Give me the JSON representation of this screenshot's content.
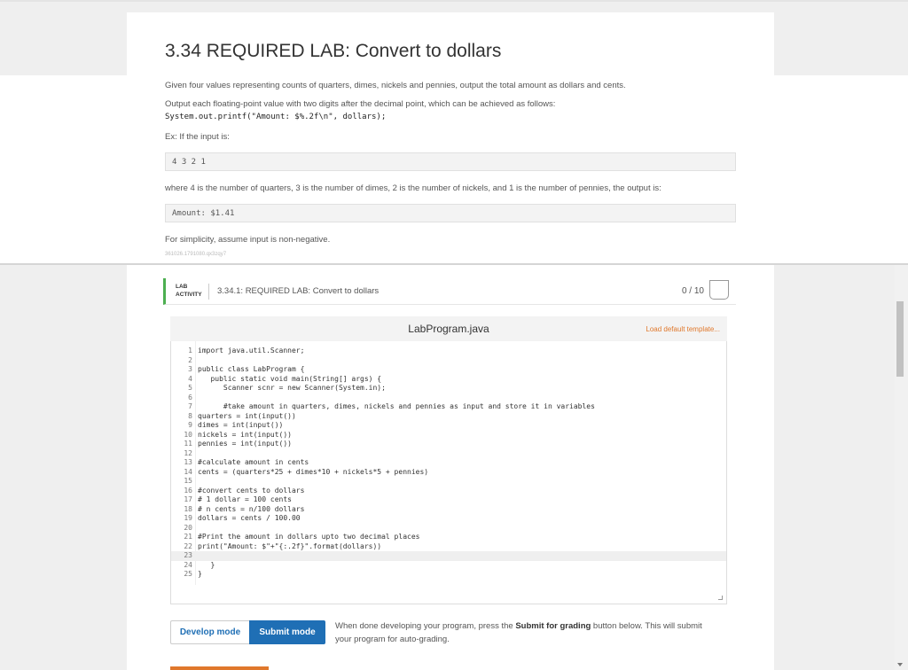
{
  "problem": {
    "title": "3.34 REQUIRED LAB: Convert to dollars",
    "intro": "Given four values representing counts of quarters, dimes, nickels and pennies, output the total amount as dollars and cents.",
    "output_note": "Output each floating-point value with two digits after the decimal point, which can be achieved as follows:",
    "printf_code": "System.out.printf(\"Amount: $%.2f\\n\", dollars);",
    "example_label": "Ex: If the input is:",
    "example_input": "4 3 2 1",
    "where_text": "where 4 is the number of quarters, 3 is the number of dimes, 2 is the number of nickels, and 1 is the number of pennies, the output is:",
    "example_output": "Amount: $1.41",
    "simplicity_note": "For simplicity, assume input is non-negative.",
    "tiny_id": "361026.1791080.qx3zqy7"
  },
  "activity": {
    "type_line1": "LAB",
    "type_line2": "ACTIVITY",
    "title": "3.34.1: REQUIRED LAB: Convert to dollars",
    "score": "0 / 10"
  },
  "editor": {
    "filename": "LabProgram.java",
    "load_template": "Load default template...",
    "lines": [
      {
        "n": "1",
        "text": "import java.util.Scanner;"
      },
      {
        "n": "2",
        "text": ""
      },
      {
        "n": "3",
        "text": "public class LabProgram {"
      },
      {
        "n": "4",
        "text": "   public static void main(String[] args) {"
      },
      {
        "n": "5",
        "text": "      Scanner scnr = new Scanner(System.in);"
      },
      {
        "n": "6",
        "text": ""
      },
      {
        "n": "7",
        "text": "      #take amount in quarters, dimes, nickels and pennies as input and store it in variables"
      },
      {
        "n": "8",
        "text": "quarters = int(input())"
      },
      {
        "n": "9",
        "text": "dimes = int(input())"
      },
      {
        "n": "10",
        "text": "nickels = int(input())"
      },
      {
        "n": "11",
        "text": "pennies = int(input())"
      },
      {
        "n": "12",
        "text": ""
      },
      {
        "n": "13",
        "text": "#calculate amount in cents"
      },
      {
        "n": "14",
        "text": "cents = (quarters*25 + dimes*10 + nickels*5 + pennies)"
      },
      {
        "n": "15",
        "text": ""
      },
      {
        "n": "16",
        "text": "#convert cents to dollars"
      },
      {
        "n": "17",
        "text": "# 1 dollar = 100 cents"
      },
      {
        "n": "18",
        "text": "# n cents = n/100 dollars"
      },
      {
        "n": "19",
        "text": "dollars = cents / 100.00"
      },
      {
        "n": "20",
        "text": ""
      },
      {
        "n": "21",
        "text": "#Print the amount in dollars upto two decimal places"
      },
      {
        "n": "22",
        "text": "print(\"Amount: $\"+\"{:.2f}\".format(dollars))"
      },
      {
        "n": "23",
        "text": ""
      },
      {
        "n": "24",
        "text": "   }"
      },
      {
        "n": "25",
        "text": "}"
      }
    ],
    "highlight_line": 23
  },
  "modes": {
    "develop_label": "Develop mode",
    "submit_label": "Submit mode",
    "note_before": "When done developing your program, press the ",
    "note_bold": "Submit for grading",
    "note_after": " button below. This will submit your program for auto-grading."
  }
}
